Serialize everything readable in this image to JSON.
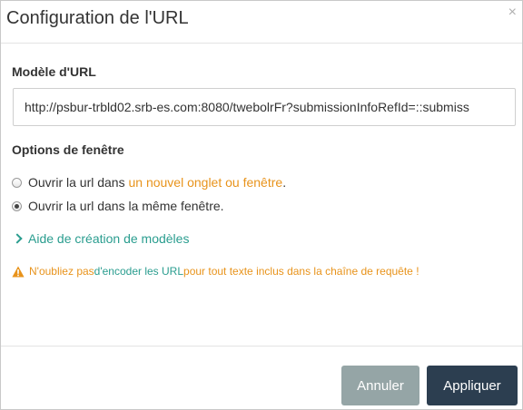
{
  "dialog": {
    "title": "Configuration de l'URL",
    "close_symbol": "×"
  },
  "url_section": {
    "label": "Modèle d'URL",
    "value": "http://psbur-trbld02.srb-es.com:8080/twebolrFr?submissionInfoRefId=::submiss"
  },
  "window_options": {
    "label": "Options de fenêtre",
    "option_new": {
      "prefix": "Ouvrir la url dans ",
      "highlight": "un nouvel onglet ou fenêtre",
      "suffix": ".",
      "checked": false
    },
    "option_same": {
      "label": "Ouvrir la url dans la même fenêtre.",
      "checked": true
    }
  },
  "help": {
    "icon": "chevron-right-icon",
    "label": "Aide de création de modèles"
  },
  "warning": {
    "icon": "warning-icon",
    "part1": "N'oubliez pas ",
    "part2": "d'encoder les URL",
    "part3": " pour tout texte inclus dans la chaîne de requête !"
  },
  "buttons": {
    "cancel": "Annuler",
    "apply": "Appliquer"
  },
  "colors": {
    "orange": "#e8931b",
    "teal": "#2a9d8f",
    "cancel_bg": "#95a5a6",
    "apply_bg": "#2c3e50"
  }
}
